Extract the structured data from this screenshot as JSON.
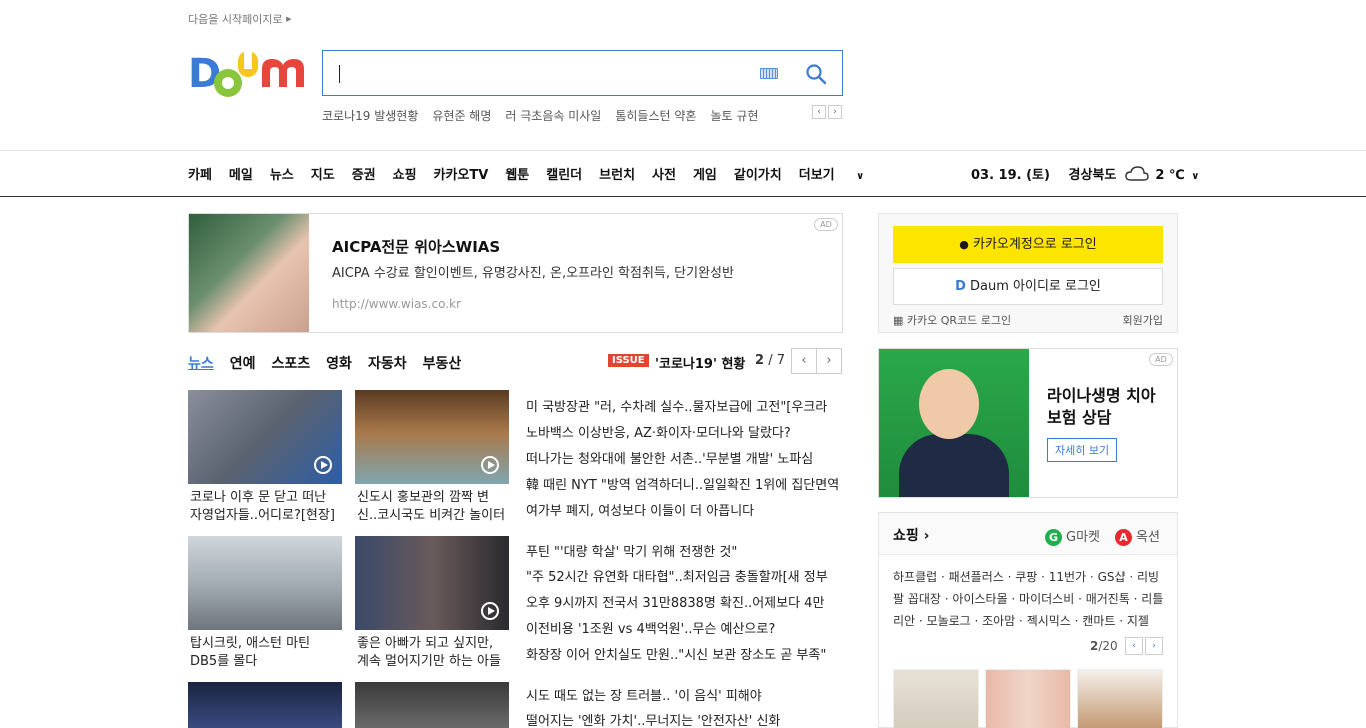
{
  "header": {
    "start_page": "다음을 시작페이지로",
    "issues": [
      "코로나19 발생현황",
      "유현준 해명",
      "러 극초음속 미사일",
      "톰히들스턴 약혼",
      "놀토 규현"
    ]
  },
  "nav": {
    "items": [
      "카페",
      "메일",
      "뉴스",
      "지도",
      "증권",
      "쇼핑",
      "카카오TV",
      "웹툰",
      "캘린더",
      "브런치",
      "사전",
      "게임",
      "같이가치",
      "더보기"
    ],
    "date": "03. 19. (토)",
    "region": "경상북도",
    "temp": "2 ℃"
  },
  "ad_top": {
    "badge": "AD",
    "title": "AICPA전문 위아스WIAS",
    "desc": "AICPA 수강료 할인이벤트, 유명강사진, 온,오프라인 학점취득, 단기완성반",
    "url": "http://www.wias.co.kr"
  },
  "news_tabs": {
    "items": [
      "뉴스",
      "연예",
      "스포츠",
      "영화",
      "자동차",
      "부동산"
    ],
    "issue_badge": "ISSUE",
    "issue_text": "'코로나19' 현황",
    "page_current": "2",
    "page_total": "/ 7"
  },
  "news_thumbs": [
    "코로나 이후 문 닫고 떠난 자영업자들..어디로?[현장]",
    "신도시 홍보관의 깜짝 변신..코시국도 비켜간 놀이터",
    "탑시크릿, 애스턴 마틴 DB5를 몰다",
    "좋은 아빠가 되고 싶지만, 계속 멀어지기만 하는 아들"
  ],
  "headlines": [
    "미 국방장관 \"러, 수차례 실수..물자보급에 고전\"[우크라",
    "노바백스 이상반응, AZ·화이자·모더나와 달랐다?",
    "떠나가는 청와대에 불안한 서촌..'무분별 개발' 노파심",
    "韓 때린 NYT \"방역 엄격하더니..일일확진 1위에 집단면역",
    "여가부 폐지, 여성보다 이들이 더 아픕니다",
    "푸틴 \"'대량 학살' 막기 위해 전쟁한 것\"",
    "\"주 52시간 유연화 대타협\"..최저임금 충돌할까[새 정부",
    "오후 9시까지 전국서 31만8838명 확진..어제보다 4만",
    "이전비용 '1조원 vs 4백억원'..무슨 예산으로?",
    "화장장 이어 안치실도 만원..\"시신 보관 장소도 곧 부족\"",
    "시도 때도 없는 장 트러블.. '이 음식' 피해야",
    "떨어지는 '엔화 가치'..무너지는 '안전자산' 신화"
  ],
  "login": {
    "kakao": "카카오계정으로 로그인",
    "daum": "Daum 아이디로 로그인",
    "qr": "카카오 QR코드 로그인",
    "join": "회원가입"
  },
  "ad_right": {
    "badge": "AD",
    "title": "라이나생명 치아보험 상담",
    "button": "자세히 보기"
  },
  "shopping": {
    "title": "쇼핑",
    "gmarket": "G마켓",
    "auction": "옥션",
    "links": "하프클럽 · 패션플러스 · 쿠팡 · 11번가 · GS샵 · 리빙팔 꼽대장 · 아이스타몰 · 마이더스비 · 매거진톡 · 리틀리안 · 모놀로그 · 조아맘 · 젝시믹스 · 캔마트 · 지젤",
    "page_current": "2",
    "page_total": "/20"
  }
}
